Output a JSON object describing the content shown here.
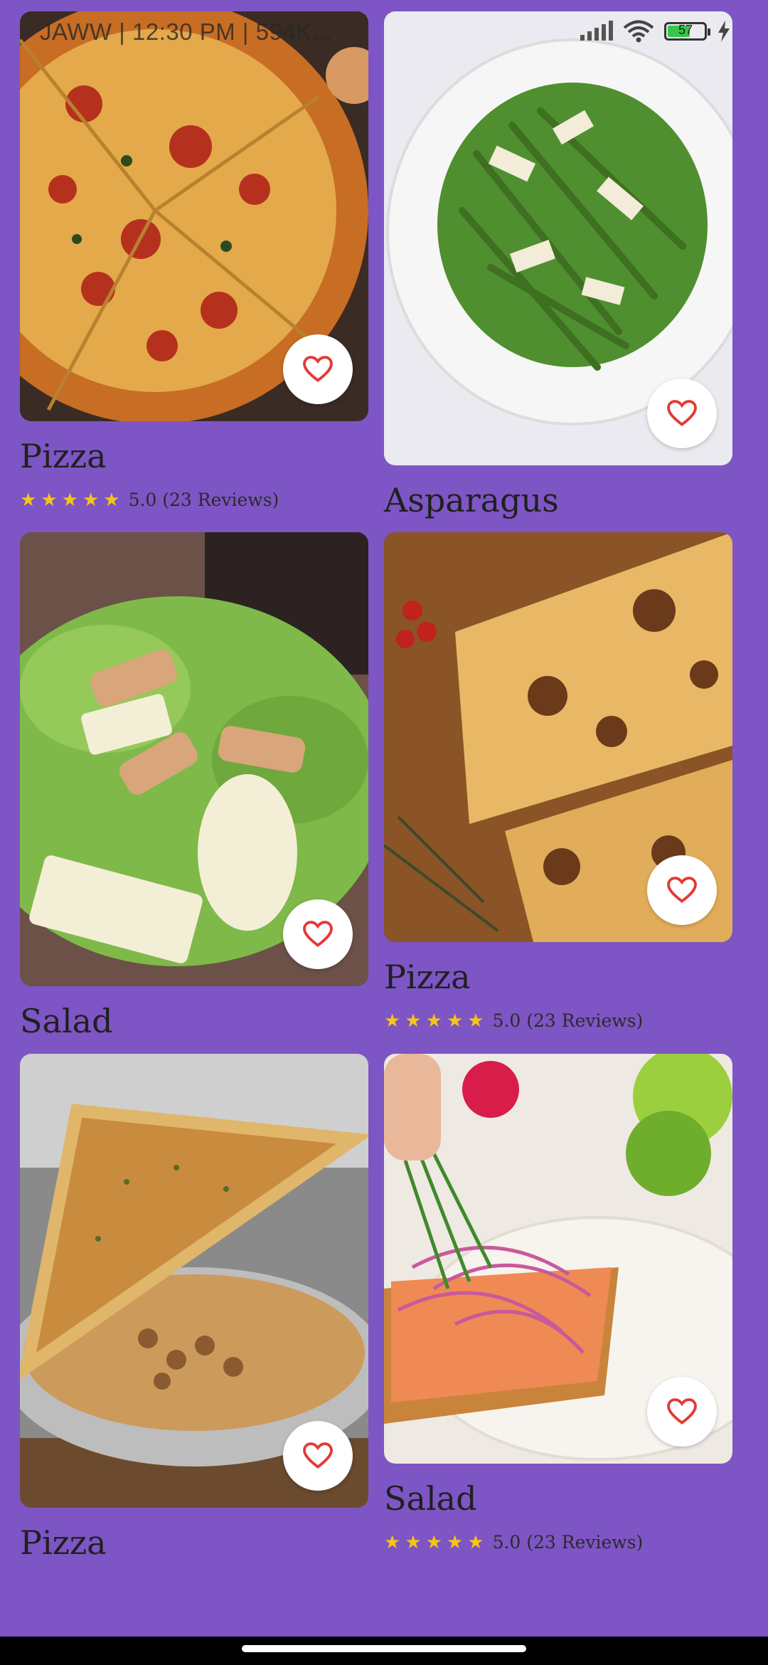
{
  "status_bar": {
    "left_text": "JAWW | 12:30 PM | 594K...",
    "battery": "57"
  },
  "cards": [
    {
      "title": "Pizza",
      "rating_text": "5.0 (23 Reviews)",
      "photo": "pizza slices on board"
    },
    {
      "title": "Asparagus",
      "photo": "asparagus salad plate"
    },
    {
      "title": "Salad",
      "photo": "caesar salad"
    },
    {
      "title": "Pizza",
      "rating_text": "5.0 (23 Reviews)",
      "photo": "cheesy pizza on wood"
    },
    {
      "title": "Pizza",
      "photo": "garlic toast with beans"
    },
    {
      "title": "Salad",
      "rating_text": "5.0 (23 Reviews)",
      "photo": "salmon salad toast"
    }
  ],
  "colors": {
    "background": "#7e55c4",
    "heart": "#e53935",
    "star": "#f5c518"
  },
  "icons": {
    "favorite": "heart-outline-icon",
    "rating": "star-icon"
  }
}
